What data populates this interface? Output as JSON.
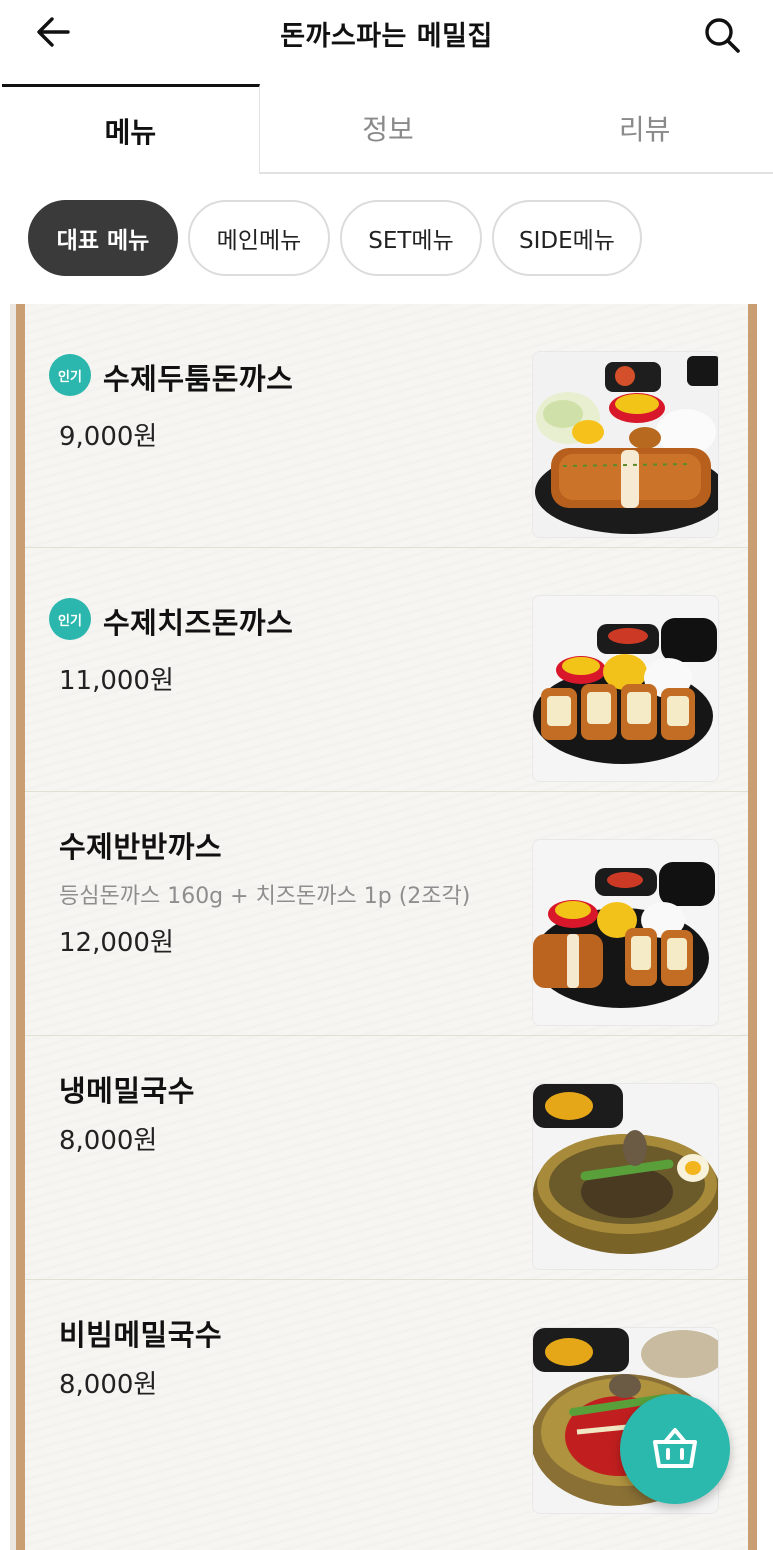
{
  "header": {
    "title": "돈까스파는 메밀집",
    "back_icon": "arrow-left-icon",
    "search_icon": "search-icon"
  },
  "tabs": [
    {
      "label": "메뉴",
      "active": true
    },
    {
      "label": "정보",
      "active": false
    },
    {
      "label": "리뷰",
      "active": false
    }
  ],
  "categories": [
    {
      "label": "대표 메뉴",
      "active": true
    },
    {
      "label": "메인메뉴",
      "active": false
    },
    {
      "label": "SET메뉴",
      "active": false
    },
    {
      "label": "SIDE메뉴",
      "active": false
    }
  ],
  "menu": [
    {
      "name": "수제두툼돈까스",
      "badge": "인기",
      "description": "",
      "price": "9,000원",
      "image": "pork-cutlet-plate"
    },
    {
      "name": "수제치즈돈까스",
      "badge": "인기",
      "description": "",
      "price": "11,000원",
      "image": "cheese-cutlet-plate"
    },
    {
      "name": "수제반반까스",
      "badge": "",
      "description": "등심돈까스 160g + 치즈돈까스 1p (2조각)",
      "price": "12,000원",
      "image": "half-half-cutlet-plate"
    },
    {
      "name": "냉메밀국수",
      "badge": "",
      "description": "",
      "price": "8,000원",
      "image": "cold-buckwheat-noodles"
    },
    {
      "name": "비빔메밀국수",
      "badge": "",
      "description": "",
      "price": "8,000원",
      "image": "spicy-buckwheat-noodles"
    }
  ],
  "cart": {
    "icon": "basket-icon"
  },
  "colors": {
    "accent": "#2cb9ad",
    "board_frame": "#c99e72",
    "active_chip": "#3a3a3a"
  }
}
